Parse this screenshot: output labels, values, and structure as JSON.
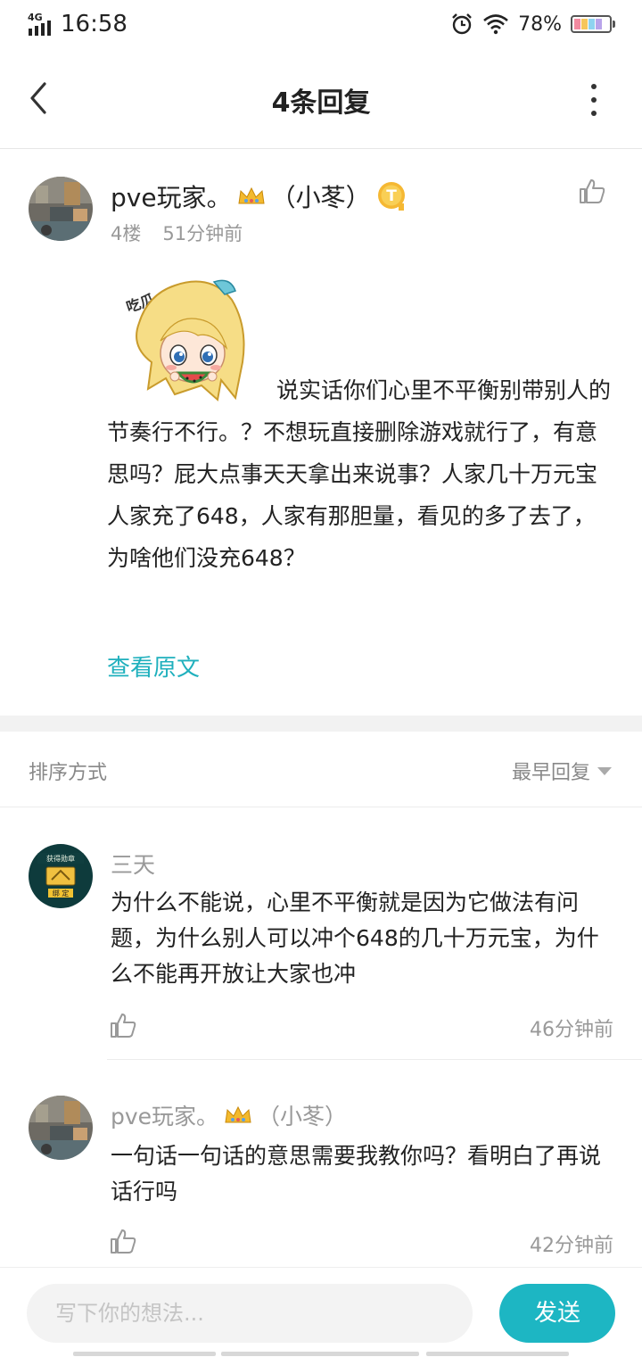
{
  "status_bar": {
    "network": "4G",
    "time": "16:58",
    "battery": "78%"
  },
  "header": {
    "title": "4条回复"
  },
  "post": {
    "username": "pve玩家。",
    "username_tag": "（小苳）",
    "badge_letter": "T",
    "floor": "4楼",
    "time": "51分钟前",
    "sticker_caption": "吃瓜…",
    "text": "说实话你们心里不平衡别带别人的节奏行不行。？不想玩直接删除游戏就行了，有意思吗？屁大点事天天拿出来说事？人家几十万元宝人家充了648，人家有那胆量，看见的多了去了，为啥他们没充648？",
    "view_original": "查看原文"
  },
  "sort": {
    "label": "排序方式",
    "value": "最早回复"
  },
  "replies": [
    {
      "username": "三天",
      "avatar_badge": "获得勋章",
      "avatar_button": "绑 定",
      "text": "为什么不能说，心里不平衡就是因为它做法有问题，为什么别人可以冲个648的几十万元宝，为什么不能再开放让大家也冲",
      "time": "46分钟前"
    },
    {
      "username": "pve玩家。",
      "username_tag": "（小苳）",
      "text": "一句话一句话的意思需要我教你吗？看明白了再说话行吗",
      "time": "42分钟前"
    }
  ],
  "composer": {
    "placeholder": "写下你的想法...",
    "send_label": "发送"
  },
  "colors": {
    "accent": "#1db6c3",
    "link": "#1fb0bd",
    "muted": "#999999"
  }
}
